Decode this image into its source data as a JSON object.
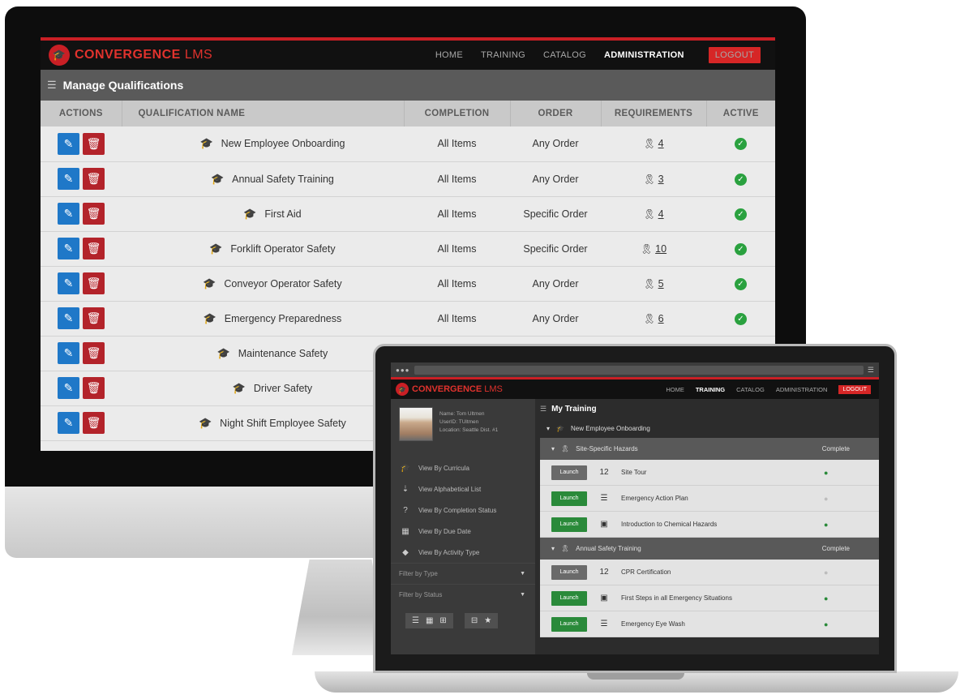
{
  "desktop": {
    "logo": {
      "brand": "CONVERGENCE",
      "suffix": "LMS"
    },
    "nav": {
      "home": "HOME",
      "training": "TRAINING",
      "catalog": "CATALOG",
      "administration": "ADMINISTRATION",
      "logout": "LOGOUT"
    },
    "page_title": "Manage Qualifications",
    "columns": {
      "actions": "ACTIONS",
      "name": "QUALIFICATION NAME",
      "completion": "COMPLETION",
      "order": "ORDER",
      "requirements": "REQUIREMENTS",
      "active": "ACTIVE"
    },
    "rows": [
      {
        "name": "New Employee Onboarding",
        "completion": "All Items",
        "order": "Any Order",
        "requirements": "4",
        "active": true
      },
      {
        "name": "Annual Safety Training",
        "completion": "All Items",
        "order": "Any Order",
        "requirements": "3",
        "active": true
      },
      {
        "name": "First Aid",
        "completion": "All Items",
        "order": "Specific Order",
        "requirements": "4",
        "active": true
      },
      {
        "name": "Forklift Operator Safety",
        "completion": "All Items",
        "order": "Specific Order",
        "requirements": "10",
        "active": true
      },
      {
        "name": "Conveyor Operator Safety",
        "completion": "All Items",
        "order": "Any Order",
        "requirements": "5",
        "active": true
      },
      {
        "name": "Emergency Preparedness",
        "completion": "All Items",
        "order": "Any Order",
        "requirements": "6",
        "active": true
      },
      {
        "name": "Maintenance Safety",
        "completion": "",
        "order": "",
        "requirements": "",
        "active": false
      },
      {
        "name": "Driver Safety",
        "completion": "",
        "order": "",
        "requirements": "",
        "active": false
      },
      {
        "name": "Night Shift Employee Safety",
        "completion": "",
        "order": "",
        "requirements": "",
        "active": false
      }
    ]
  },
  "laptop": {
    "logo": {
      "brand": "CONVERGENCE",
      "suffix": "LMS"
    },
    "nav": {
      "home": "HOME",
      "training": "TRAINING",
      "catalog": "CATALOG",
      "administration": "ADMINISTRATION",
      "logout": "LOGOUT"
    },
    "profile": {
      "name": "Name: Tom Ultmen",
      "userid": "UserID: TUltmen",
      "location": "Location: Seattle Dist. #1"
    },
    "side_items": [
      {
        "label": "View By Curricula",
        "icon": "cap-icon"
      },
      {
        "label": "View Alphabetical List",
        "icon": "sort-icon"
      },
      {
        "label": "View By Completion Status",
        "icon": "question-icon"
      },
      {
        "label": "View By Due Date",
        "icon": "calendar-icon"
      },
      {
        "label": "View By Activity Type",
        "icon": "tag-icon"
      }
    ],
    "filters": {
      "type": "Filter by Type",
      "status": "Filter by Status"
    },
    "title": "My Training",
    "curriculum": "New Employee Onboarding",
    "sections": [
      {
        "name": "Site-Specific Hazards",
        "status": "Complete",
        "activities": [
          {
            "launch": "Launch",
            "launch_style": "grey",
            "icon": "calendar-icon",
            "icon_glyph": "12",
            "name": "Site Tour",
            "dot": "green"
          },
          {
            "launch": "Launch",
            "launch_style": "green",
            "icon": "list-icon",
            "icon_glyph": "☰",
            "name": "Emergency Action Plan",
            "dot": "grey"
          },
          {
            "launch": "Launch",
            "launch_style": "green",
            "icon": "video-icon",
            "icon_glyph": "▣",
            "name": "Introduction to Chemical Hazards",
            "dot": "green"
          }
        ]
      },
      {
        "name": "Annual Safety Training",
        "status": "Complete",
        "activities": [
          {
            "launch": "Launch",
            "launch_style": "grey",
            "icon": "calendar-icon",
            "icon_glyph": "12",
            "name": "CPR Certification",
            "dot": "grey"
          },
          {
            "launch": "Launch",
            "launch_style": "green",
            "icon": "video-icon",
            "icon_glyph": "▣",
            "name": "First Steps in all Emergency Situations",
            "dot": "green"
          },
          {
            "launch": "Launch",
            "launch_style": "green",
            "icon": "list-icon",
            "icon_glyph": "☰",
            "name": "Emergency Eye Wash",
            "dot": "green"
          }
        ]
      }
    ]
  },
  "colors": {
    "brand_red": "#c91f25",
    "edit_blue": "#1f78c8",
    "delete_red": "#b3232a",
    "active_green": "#2aa13f"
  }
}
